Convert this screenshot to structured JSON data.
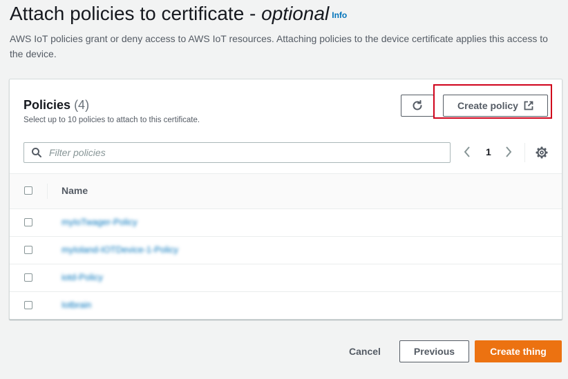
{
  "header": {
    "title": "Attach policies to certificate - ",
    "title_optional": "optional",
    "info_link": "Info",
    "description": "AWS IoT policies grant or deny access to AWS IoT resources. Attaching policies to the device certificate applies this access to the device."
  },
  "panel": {
    "title": "Policies",
    "count": "(4)",
    "subtitle": "Select up to 10 policies to attach to this certificate.",
    "create_policy_label": "Create policy",
    "search_placeholder": "Filter policies",
    "page_number": "1",
    "column_name": "Name",
    "rows": [
      {
        "name": "myIoTwager-Policy"
      },
      {
        "name": "myIoland-IOTDevice-1-Policy"
      },
      {
        "name": "iotd-Policy"
      },
      {
        "name": "Iotbrain"
      }
    ]
  },
  "footer": {
    "cancel_label": "Cancel",
    "previous_label": "Previous",
    "create_thing_label": "Create thing"
  },
  "colors": {
    "accent": "#ec7211",
    "link": "#0073bb",
    "highlight": "#d0021b"
  },
  "icons": [
    "refresh-icon",
    "external-link-icon",
    "search-icon",
    "chevron-left-icon",
    "chevron-right-icon",
    "gear-icon"
  ]
}
